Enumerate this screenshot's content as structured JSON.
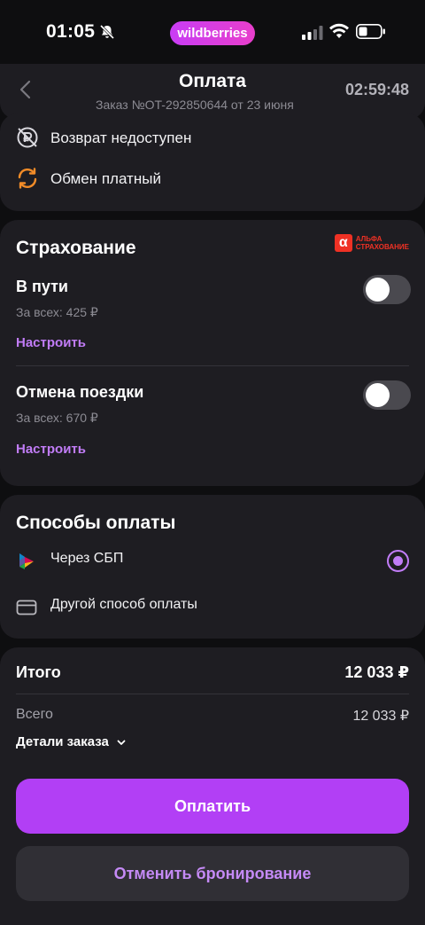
{
  "status_bar": {
    "time": "01:05",
    "brand": "wildberries",
    "icons": [
      "bell-muted-icon",
      "signal-icon",
      "wifi-icon",
      "battery-icon"
    ]
  },
  "header": {
    "title": "Оплата",
    "subtitle": "Заказ №OT-292850644 от 23 июня",
    "timer": "02:59:48"
  },
  "conditions": {
    "items": [
      {
        "label": "Возврат недоступен",
        "icon": "refund-unavailable-icon"
      },
      {
        "label": "Обмен платный",
        "icon": "exchange-icon"
      }
    ]
  },
  "insurance": {
    "title": "Страхование",
    "partner_mark": "α",
    "partner_line1": "АЛЬФА",
    "partner_line2": "СТРАХОВАНИЕ",
    "options": [
      {
        "name": "В пути",
        "price": "За всех: 425 ₽",
        "link": "Настроить",
        "enabled": false
      },
      {
        "name": "Отмена поездки",
        "price": "За всех: 670 ₽",
        "link": "Настроить",
        "enabled": false
      }
    ]
  },
  "payment_methods": {
    "title": "Способы оплаты",
    "options": [
      {
        "label": "Через СБП",
        "icon": "sbp-icon",
        "selected": true
      },
      {
        "label": "Другой способ оплаты",
        "icon": "card-icon",
        "selected": false
      }
    ]
  },
  "summary": {
    "total_label": "Итого",
    "total_value": "12 033 ₽",
    "all_label": "Всего",
    "all_value": "12 033 ₽",
    "details_label": "Детали заказа"
  },
  "actions": {
    "pay": "Оплатить",
    "cancel": "Отменить бронирование"
  },
  "colors": {
    "accent": "#b23ff5",
    "link": "#c17cf7",
    "card_bg": "#1e1d22",
    "page_bg": "#0e0e10"
  }
}
